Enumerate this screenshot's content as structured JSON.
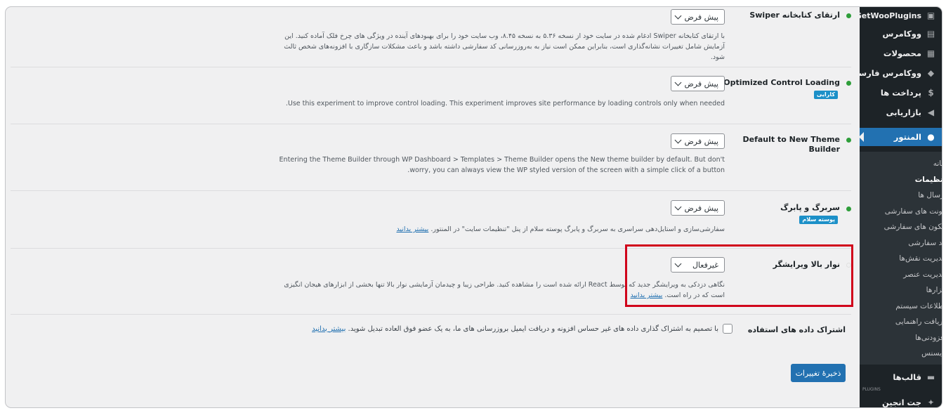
{
  "sidebar": {
    "items": [
      {
        "label": "GetWooPlugins",
        "icon": "plugin-icon"
      },
      {
        "label": "ووکامرس",
        "icon": "woo-icon"
      },
      {
        "label": "محصولات",
        "icon": "archive-icon"
      },
      {
        "label": "ووکامرس فارسی",
        "icon": "cart-icon"
      },
      {
        "label": "پرداخت ها",
        "icon": "dollar-icon"
      },
      {
        "label": "بازاریابی",
        "icon": "megaphone-icon"
      }
    ],
    "active": {
      "label": "المنتور",
      "icon": "elementor-icon"
    },
    "submenu": [
      "خانه",
      "تنظیمات",
      "ارسال ها",
      "فونت های سفارشی",
      "آیکون های سفارشی",
      "کد سفارشی",
      "مدیریت نقش‌ها",
      "مدیریت عنصر",
      "ابزارها",
      "اطلاعات سیستم",
      "دریافت راهنمایی",
      "افزودنی‌ها",
      "لایسنس"
    ],
    "after": [
      {
        "label": "قالب‌ها",
        "icon": "folder-icon"
      },
      {
        "label": "جت انجین",
        "icon": "jet-icon"
      }
    ],
    "small_tag": "PLUGINS"
  },
  "rows": [
    {
      "title": "ارتقای کتابخانه Swiper",
      "select": "پیش فرض",
      "desc": "با ارتقای کتابخانه Swiper ادغام شده در سایت خود از نسخه ۵.۳۶ به نسخه ۸.۴۵، وب سایت خود را برای بهبودهای آینده در ویژگی های چرخ فلک آماده کنید. این آزمایش شامل تغییرات نشانه‌گذاری است، بنابراین ممکن است نیاز به به‌روزرسانی کد سفارشی داشته باشد و باعث مشکلات سازگاری با افزونه‌های شخص ثالث شود."
    },
    {
      "title": "Optimized Control Loading",
      "tag": "کارایی",
      "select": "پیش فرض",
      "desc": "Use this experiment to improve control loading. This experiment improves site performance by loading controls only when needed."
    },
    {
      "title": "Default to New Theme Builder",
      "select": "پیش فرض",
      "desc": "Entering the Theme Builder through WP Dashboard > Templates > Theme Builder opens the New theme builder by default. But don't worry, you can always view the WP styled version of the screen with a simple click of a button."
    },
    {
      "title": "سربرگ و پابرگ",
      "tag": "پوسته سلام",
      "select": "پیش فرض",
      "desc": "سفارشی‌سازی و استایل‌دهی سراسری به سربرگ و پابرگ پوسته سلام از پنل \"تنظیمات سایت\" در المنتور.",
      "link": "بیشتر بدانید"
    },
    {
      "title": "نوار بالا ویرایشگر",
      "select": "غیرفعال",
      "desc": "نگاهی دزدکی به ویرایشگر جدید که توسط React ارائه شده است را مشاهده کنید. طراحی زیبا و چیدمان آزمایشی نوار بالا تنها بخشی از ابزارهای هیجان انگیزی است که در راه است.",
      "link": "بیشتر بدانید"
    }
  ],
  "usage": {
    "title": "اشتراک داده های استفاده",
    "text": "با تصمیم به اشتراک گذاری داده های غیر حساس افزونه و دریافت ایمیل بروزرسانی های ما، به یک عضو فوق العاده تبدیل شوید.",
    "link": "بیشتر بدانید"
  },
  "save_label": "ذخیرهٔ تغییرات",
  "colors": {
    "accent": "#2271b1",
    "sidebar_bg": "#1d2327",
    "active_dot": "#2e9e3a",
    "tag_blue": "#1c90c8",
    "highlight_red": "#d0021b"
  }
}
